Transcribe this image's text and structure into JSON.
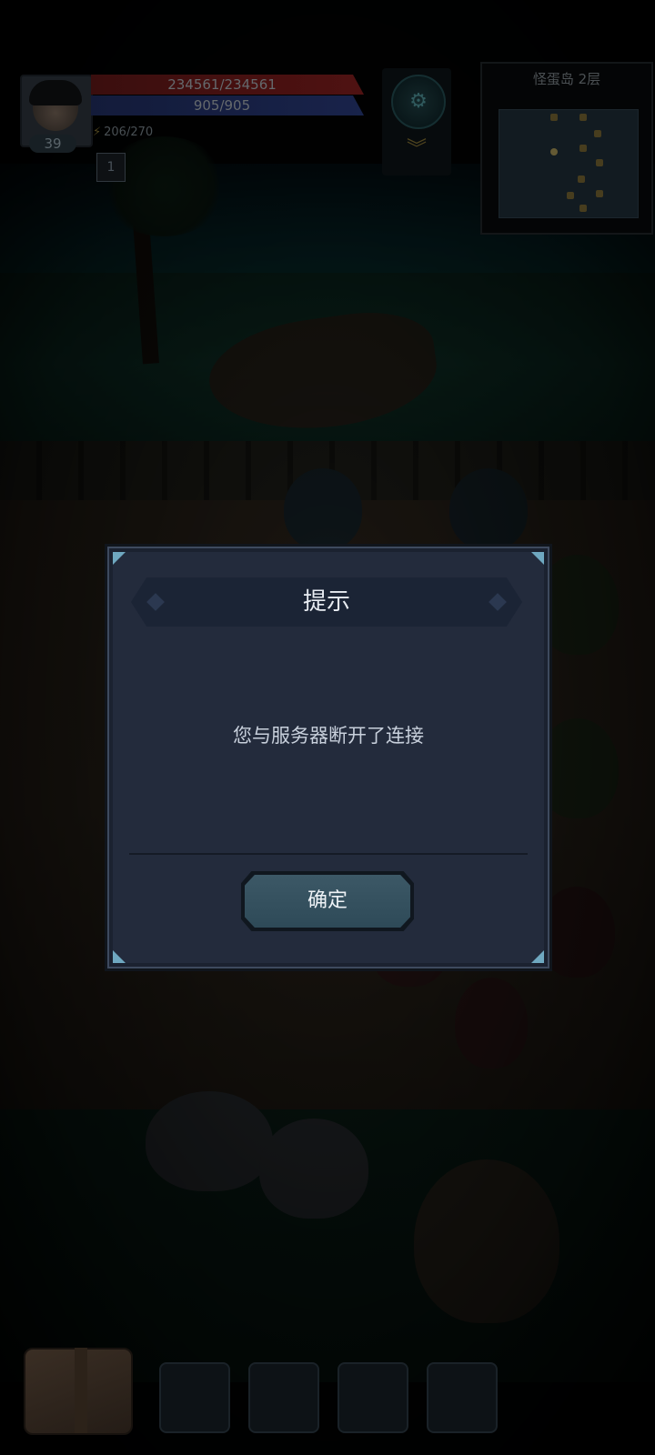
{
  "hud": {
    "level": "39",
    "hp": "234561/234561",
    "mp": "905/905",
    "energy": "206/270",
    "buff_count": "1"
  },
  "minimap": {
    "title": "怪蛋岛 2层"
  },
  "dialog": {
    "title": "提示",
    "message": "您与服务器断开了连接",
    "confirm_label": "确定"
  },
  "quick_slots": [
    "",
    "",
    "",
    ""
  ],
  "colors": {
    "dialog_bg": "#232b3c",
    "dialog_border": "#3e4a5e",
    "button_bg": "#3c5866",
    "corner_accent": "#6fa8c0"
  },
  "icons": {
    "gear": "gear-icon",
    "chevron": "chevron-down-icon",
    "bag": "backpack-icon",
    "buff": "shield-buff-icon"
  }
}
